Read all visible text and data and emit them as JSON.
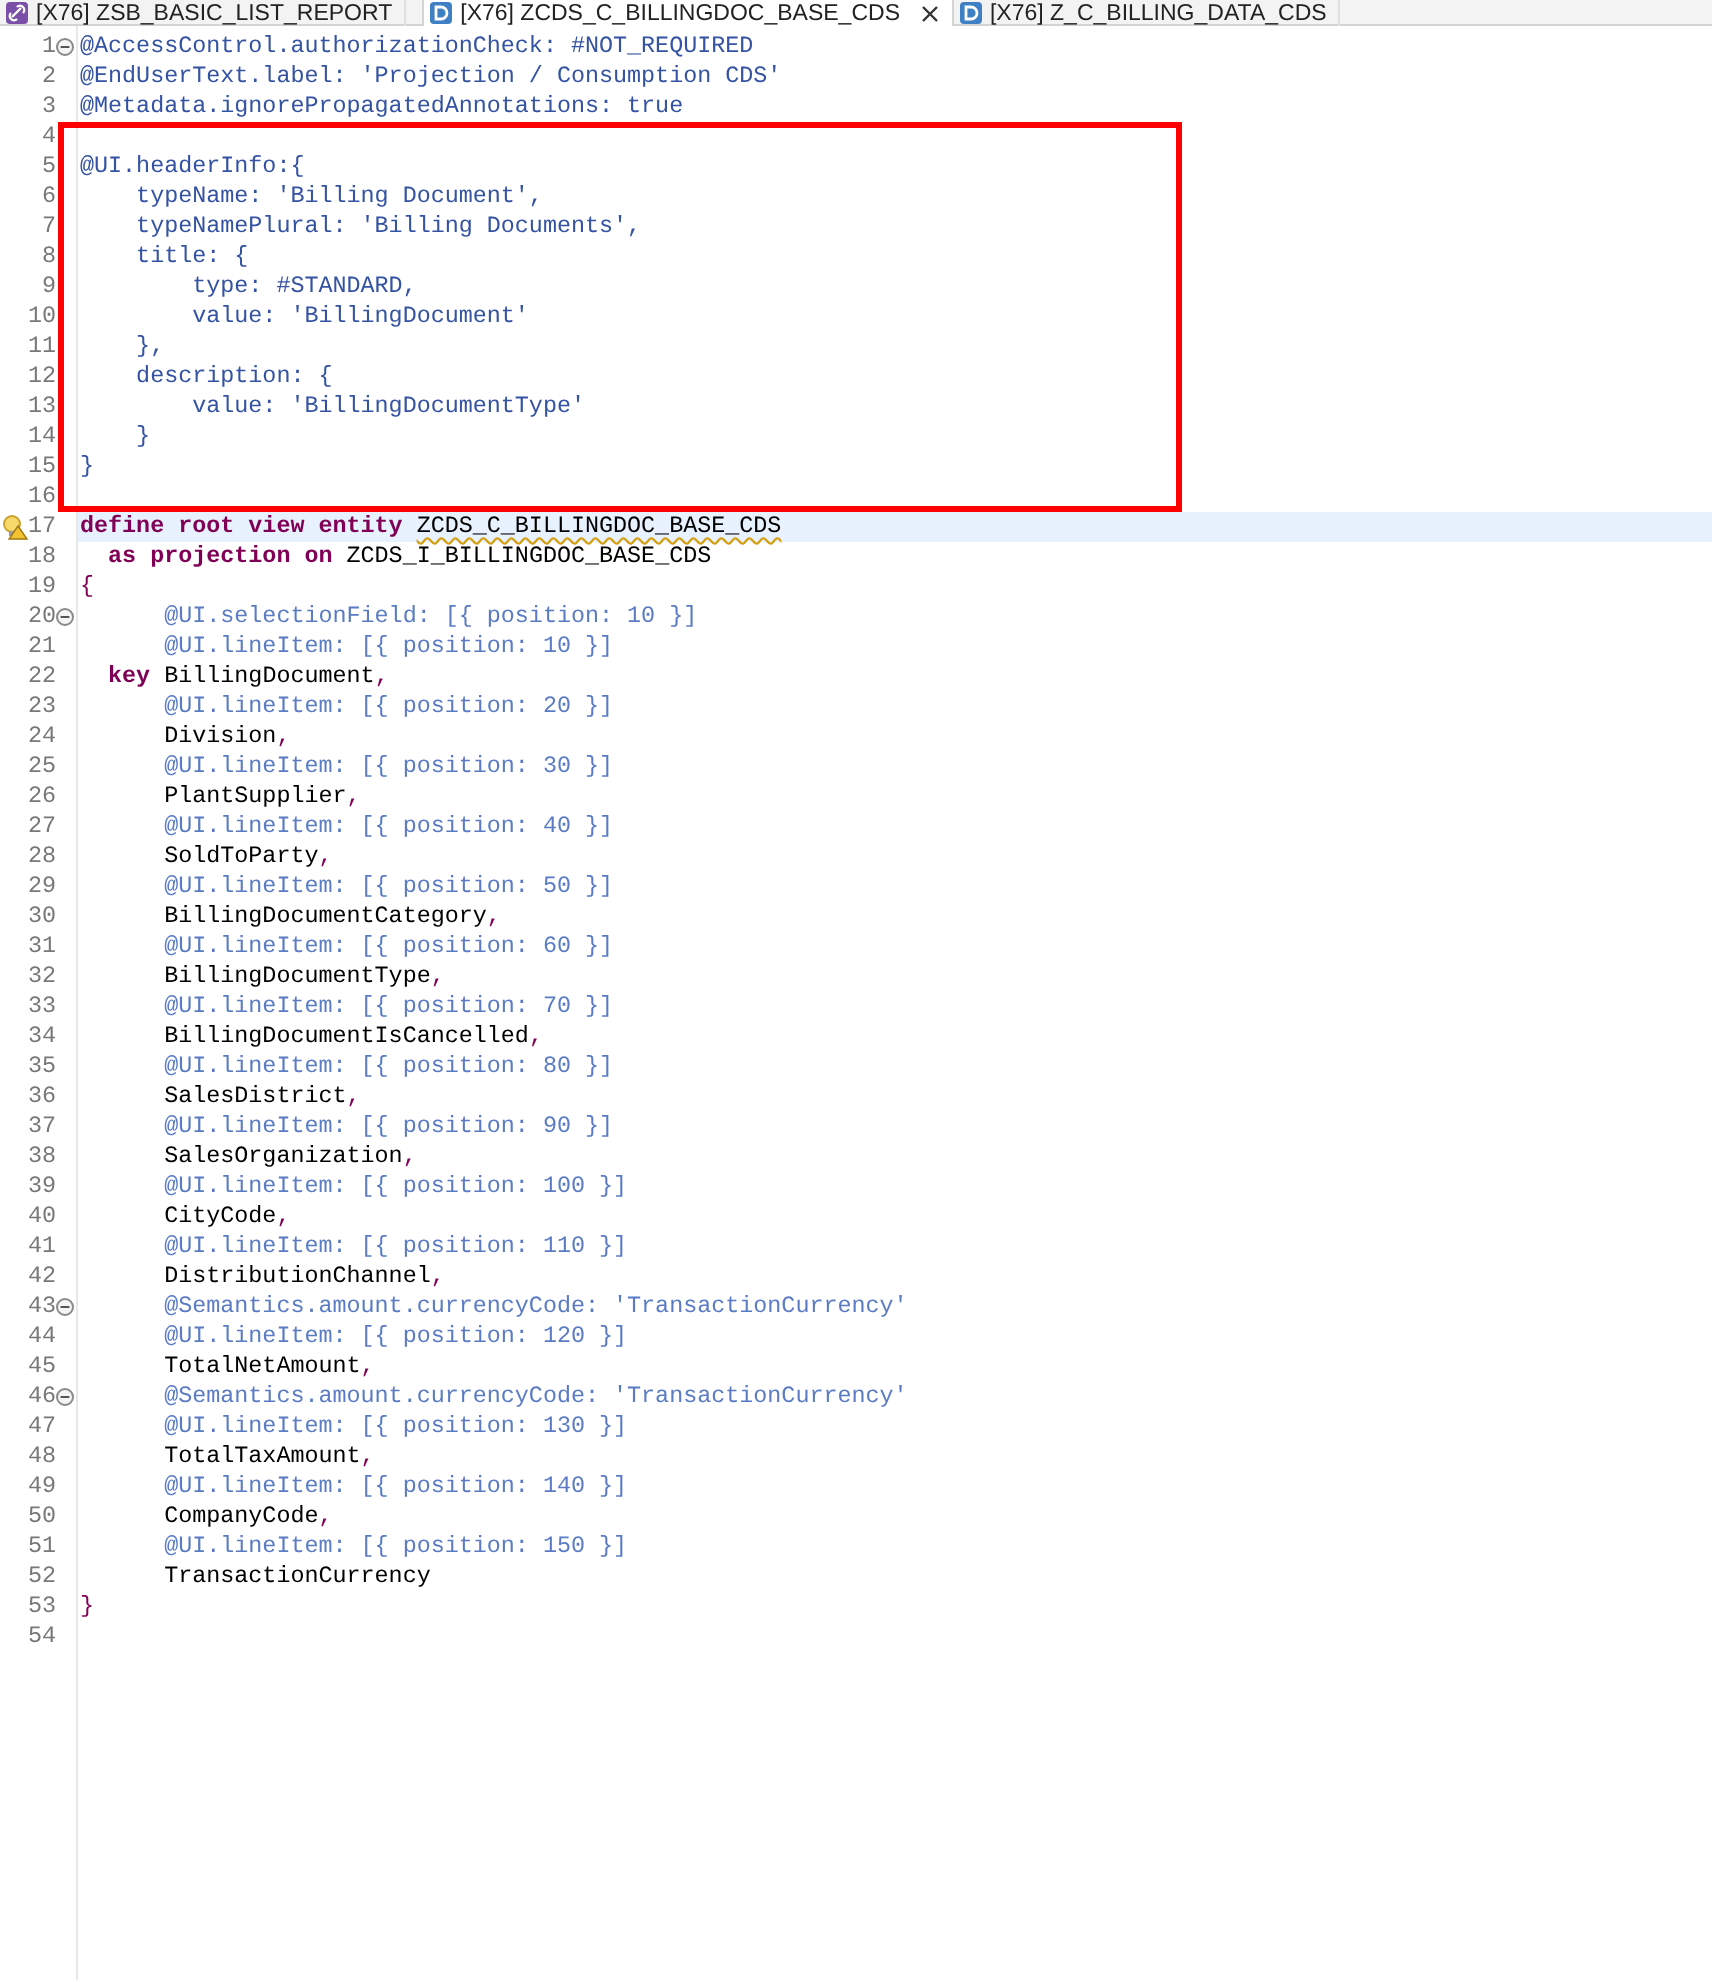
{
  "tabs": [
    {
      "label": "[X76] ZSB_BASIC_LIST_REPORT",
      "kind": "program",
      "selected": false
    },
    {
      "label": "[X76] ZCDS_C_BILLINGDOC_BASE_CDS",
      "kind": "definition",
      "selected": true
    },
    {
      "label": "[X76] Z_C_BILLING_DATA_CDS",
      "kind": "definition",
      "selected": false
    }
  ],
  "editor": {
    "lines": [
      {
        "number": "1",
        "fold": true,
        "current": false,
        "warning": false,
        "boxed": false,
        "segments": [
          {
            "kind": "annotation",
            "text": "@AccessControl.authorizationCheck: #NOT_REQUIRED"
          }
        ]
      },
      {
        "number": "2",
        "fold": false,
        "current": false,
        "warning": false,
        "boxed": false,
        "segments": [
          {
            "kind": "annotation",
            "text": "@EndUserText.label: 'Projection / Consumption CDS'"
          }
        ]
      },
      {
        "number": "3",
        "fold": false,
        "current": false,
        "warning": false,
        "boxed": false,
        "segments": [
          {
            "kind": "annotation",
            "text": "@Metadata.ignorePropagatedAnnotations: true"
          }
        ]
      },
      {
        "number": "4",
        "fold": false,
        "current": false,
        "warning": false,
        "boxed": false
      },
      {
        "number": "5",
        "fold": false,
        "current": false,
        "warning": false,
        "boxed": true,
        "segments": [
          {
            "kind": "annotation",
            "text": "@UI.headerInfo:{"
          }
        ]
      },
      {
        "number": "6",
        "fold": false,
        "current": false,
        "warning": false,
        "boxed": true,
        "segments": [
          {
            "kind": "annotation",
            "text": "    typeName: 'Billing Document',"
          }
        ]
      },
      {
        "number": "7",
        "fold": false,
        "current": false,
        "warning": false,
        "boxed": true,
        "segments": [
          {
            "kind": "annotation",
            "text": "    typeNamePlural: 'Billing Documents',"
          }
        ]
      },
      {
        "number": "8",
        "fold": false,
        "current": false,
        "warning": false,
        "boxed": true,
        "segments": [
          {
            "kind": "annotation",
            "text": "    title: {"
          }
        ]
      },
      {
        "number": "9",
        "fold": false,
        "current": false,
        "warning": false,
        "boxed": true,
        "segments": [
          {
            "kind": "annotation",
            "text": "        type: #STANDARD,"
          }
        ]
      },
      {
        "number": "10",
        "fold": false,
        "current": false,
        "warning": false,
        "boxed": true,
        "segments": [
          {
            "kind": "annotation",
            "text": "        value: 'BillingDocument'"
          }
        ]
      },
      {
        "number": "11",
        "fold": false,
        "current": false,
        "warning": false,
        "boxed": true,
        "segments": [
          {
            "kind": "annotation",
            "text": "    },"
          }
        ]
      },
      {
        "number": "12",
        "fold": false,
        "current": false,
        "warning": false,
        "boxed": true,
        "segments": [
          {
            "kind": "annotation",
            "text": "    description: {"
          }
        ]
      },
      {
        "number": "13",
        "fold": false,
        "current": false,
        "warning": false,
        "boxed": true,
        "segments": [
          {
            "kind": "annotation",
            "text": "        value: 'BillingDocumentType'"
          }
        ]
      },
      {
        "number": "14",
        "fold": false,
        "current": false,
        "warning": false,
        "boxed": true,
        "segments": [
          {
            "kind": "annotation",
            "text": "    }"
          }
        ]
      },
      {
        "number": "15",
        "fold": false,
        "current": false,
        "warning": false,
        "boxed": true,
        "segments": [
          {
            "kind": "annotation",
            "text": "}"
          }
        ]
      },
      {
        "number": "16",
        "fold": false,
        "current": false,
        "warning": false,
        "boxed": false
      },
      {
        "number": "17",
        "fold": false,
        "current": true,
        "warning": true,
        "boxed": false,
        "segments": [
          {
            "kind": "keyword",
            "text": "define root view entity "
          },
          {
            "kind": "flagged",
            "text": "ZCDS_C_BILLINGDOC_BASE_CDS"
          }
        ]
      },
      {
        "number": "18",
        "fold": false,
        "current": false,
        "warning": false,
        "boxed": false,
        "segments": [
          {
            "kind": "keyword",
            "text": "  as projection on "
          },
          {
            "kind": "name",
            "text": "ZCDS_I_BILLINGDOC_BASE_CDS"
          }
        ]
      },
      {
        "number": "19",
        "fold": false,
        "current": false,
        "warning": false,
        "boxed": false,
        "segments": [
          {
            "kind": "punct",
            "text": "{"
          }
        ]
      },
      {
        "number": "20",
        "fold": true,
        "current": false,
        "warning": false,
        "boxed": false,
        "segments": [
          {
            "kind": "element_annotation",
            "text": "      @UI.selectionField: [{ position: 10 }]"
          }
        ]
      },
      {
        "number": "21",
        "fold": false,
        "current": false,
        "warning": false,
        "boxed": false,
        "segments": [
          {
            "kind": "element_annotation",
            "text": "      @UI.lineItem: [{ position: 10 }]"
          }
        ]
      },
      {
        "number": "22",
        "fold": false,
        "current": false,
        "warning": false,
        "boxed": false,
        "segments": [
          {
            "kind": "keyword",
            "text": "  key "
          },
          {
            "kind": "name",
            "text": "BillingDocument"
          },
          {
            "kind": "punct",
            "text": ","
          }
        ]
      },
      {
        "number": "23",
        "fold": false,
        "current": false,
        "warning": false,
        "boxed": false,
        "segments": [
          {
            "kind": "element_annotation",
            "text": "      @UI.lineItem: [{ position: 20 }]"
          }
        ]
      },
      {
        "number": "24",
        "fold": false,
        "current": false,
        "warning": false,
        "boxed": false,
        "segments": [
          {
            "kind": "name",
            "text": "      Division"
          },
          {
            "kind": "punct",
            "text": ","
          }
        ]
      },
      {
        "number": "25",
        "fold": false,
        "current": false,
        "warning": false,
        "boxed": false,
        "segments": [
          {
            "kind": "element_annotation",
            "text": "      @UI.lineItem: [{ position: 30 }]"
          }
        ]
      },
      {
        "number": "26",
        "fold": false,
        "current": false,
        "warning": false,
        "boxed": false,
        "segments": [
          {
            "kind": "name",
            "text": "      PlantSupplier"
          },
          {
            "kind": "punct",
            "text": ","
          }
        ]
      },
      {
        "number": "27",
        "fold": false,
        "current": false,
        "warning": false,
        "boxed": false,
        "segments": [
          {
            "kind": "element_annotation",
            "text": "      @UI.lineItem: [{ position: 40 }]"
          }
        ]
      },
      {
        "number": "28",
        "fold": false,
        "current": false,
        "warning": false,
        "boxed": false,
        "segments": [
          {
            "kind": "name",
            "text": "      SoldToParty"
          },
          {
            "kind": "punct",
            "text": ","
          }
        ]
      },
      {
        "number": "29",
        "fold": false,
        "current": false,
        "warning": false,
        "boxed": false,
        "segments": [
          {
            "kind": "element_annotation",
            "text": "      @UI.lineItem: [{ position: 50 }]"
          }
        ]
      },
      {
        "number": "30",
        "fold": false,
        "current": false,
        "warning": false,
        "boxed": false,
        "segments": [
          {
            "kind": "name",
            "text": "      BillingDocumentCategory"
          },
          {
            "kind": "punct",
            "text": ","
          }
        ]
      },
      {
        "number": "31",
        "fold": false,
        "current": false,
        "warning": false,
        "boxed": false,
        "segments": [
          {
            "kind": "element_annotation",
            "text": "      @UI.lineItem: [{ position: 60 }]"
          }
        ]
      },
      {
        "number": "32",
        "fold": false,
        "current": false,
        "warning": false,
        "boxed": false,
        "segments": [
          {
            "kind": "name",
            "text": "      BillingDocumentType"
          },
          {
            "kind": "punct",
            "text": ","
          }
        ]
      },
      {
        "number": "33",
        "fold": false,
        "current": false,
        "warning": false,
        "boxed": false,
        "segments": [
          {
            "kind": "element_annotation",
            "text": "      @UI.lineItem: [{ position: 70 }]"
          }
        ]
      },
      {
        "number": "34",
        "fold": false,
        "current": false,
        "warning": false,
        "boxed": false,
        "segments": [
          {
            "kind": "name",
            "text": "      BillingDocumentIsCancelled"
          },
          {
            "kind": "punct",
            "text": ","
          }
        ]
      },
      {
        "number": "35",
        "fold": false,
        "current": false,
        "warning": false,
        "boxed": false,
        "segments": [
          {
            "kind": "element_annotation",
            "text": "      @UI.lineItem: [{ position: 80 }]"
          }
        ]
      },
      {
        "number": "36",
        "fold": false,
        "current": false,
        "warning": false,
        "boxed": false,
        "segments": [
          {
            "kind": "name",
            "text": "      SalesDistrict"
          },
          {
            "kind": "punct",
            "text": ","
          }
        ]
      },
      {
        "number": "37",
        "fold": false,
        "current": false,
        "warning": false,
        "boxed": false,
        "segments": [
          {
            "kind": "element_annotation",
            "text": "      @UI.lineItem: [{ position: 90 }]"
          }
        ]
      },
      {
        "number": "38",
        "fold": false,
        "current": false,
        "warning": false,
        "boxed": false,
        "segments": [
          {
            "kind": "name",
            "text": "      SalesOrganization"
          },
          {
            "kind": "punct",
            "text": ","
          }
        ]
      },
      {
        "number": "39",
        "fold": false,
        "current": false,
        "warning": false,
        "boxed": false,
        "segments": [
          {
            "kind": "element_annotation",
            "text": "      @UI.lineItem: [{ position: 100 }]"
          }
        ]
      },
      {
        "number": "40",
        "fold": false,
        "current": false,
        "warning": false,
        "boxed": false,
        "segments": [
          {
            "kind": "name",
            "text": "      CityCode"
          },
          {
            "kind": "punct",
            "text": ","
          }
        ]
      },
      {
        "number": "41",
        "fold": false,
        "current": false,
        "warning": false,
        "boxed": false,
        "segments": [
          {
            "kind": "element_annotation",
            "text": "      @UI.lineItem: [{ position: 110 }]"
          }
        ]
      },
      {
        "number": "42",
        "fold": false,
        "current": false,
        "warning": false,
        "boxed": false,
        "segments": [
          {
            "kind": "name",
            "text": "      DistributionChannel"
          },
          {
            "kind": "punct",
            "text": ","
          }
        ]
      },
      {
        "number": "43",
        "fold": true,
        "current": false,
        "warning": false,
        "boxed": false,
        "segments": [
          {
            "kind": "element_annotation",
            "text": "      @Semantics.amount.currencyCode: 'TransactionCurrency'"
          }
        ]
      },
      {
        "number": "44",
        "fold": false,
        "current": false,
        "warning": false,
        "boxed": false,
        "segments": [
          {
            "kind": "element_annotation",
            "text": "      @UI.lineItem: [{ position: 120 }]"
          }
        ]
      },
      {
        "number": "45",
        "fold": false,
        "current": false,
        "warning": false,
        "boxed": false,
        "segments": [
          {
            "kind": "name",
            "text": "      TotalNetAmount"
          },
          {
            "kind": "punct",
            "text": ","
          }
        ]
      },
      {
        "number": "46",
        "fold": true,
        "current": false,
        "warning": false,
        "boxed": false,
        "segments": [
          {
            "kind": "element_annotation",
            "text": "      @Semantics.amount.currencyCode: 'TransactionCurrency'"
          }
        ]
      },
      {
        "number": "47",
        "fold": false,
        "current": false,
        "warning": false,
        "boxed": false,
        "segments": [
          {
            "kind": "element_annotation",
            "text": "      @UI.lineItem: [{ position: 130 }]"
          }
        ]
      },
      {
        "number": "48",
        "fold": false,
        "current": false,
        "warning": false,
        "boxed": false,
        "segments": [
          {
            "kind": "name",
            "text": "      TotalTaxAmount"
          },
          {
            "kind": "punct",
            "text": ","
          }
        ]
      },
      {
        "number": "49",
        "fold": false,
        "current": false,
        "warning": false,
        "boxed": false,
        "segments": [
          {
            "kind": "element_annotation",
            "text": "      @UI.lineItem: [{ position: 140 }]"
          }
        ]
      },
      {
        "number": "50",
        "fold": false,
        "current": false,
        "warning": false,
        "boxed": false,
        "segments": [
          {
            "kind": "name",
            "text": "      CompanyCode"
          },
          {
            "kind": "punct",
            "text": ","
          }
        ]
      },
      {
        "number": "51",
        "fold": false,
        "current": false,
        "warning": false,
        "boxed": false,
        "segments": [
          {
            "kind": "element_annotation",
            "text": "      @UI.lineItem: [{ position: 150 }]"
          }
        ]
      },
      {
        "number": "52",
        "fold": false,
        "current": false,
        "warning": false,
        "boxed": false,
        "segments": [
          {
            "kind": "name",
            "text": "      TransactionCurrency"
          }
        ]
      },
      {
        "number": "53",
        "fold": false,
        "current": false,
        "warning": false,
        "boxed": false,
        "segments": [
          {
            "kind": "punct",
            "text": "}"
          }
        ]
      },
      {
        "number": "54",
        "fold": false,
        "current": false,
        "warning": false,
        "boxed": false
      }
    ]
  }
}
